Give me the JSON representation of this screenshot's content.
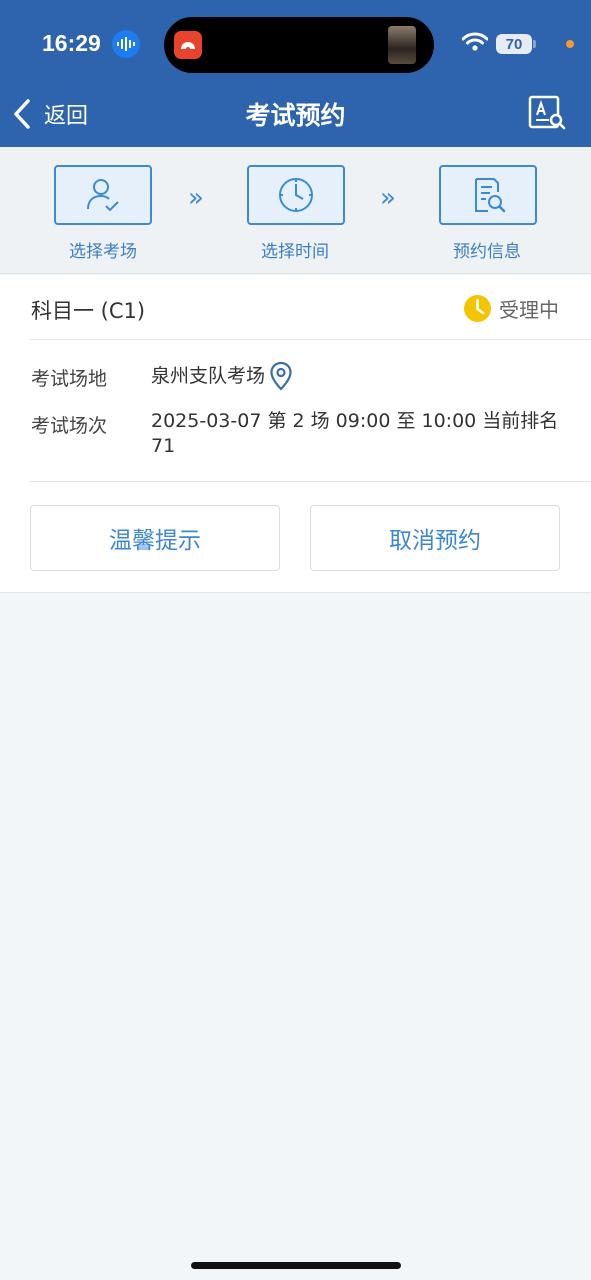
{
  "status_bar": {
    "time": "16:29",
    "battery": "70"
  },
  "nav": {
    "back_label": "返回",
    "title": "考试预约"
  },
  "steps": [
    {
      "label": "选择考场",
      "icon": "person-check-icon"
    },
    {
      "label": "选择时间",
      "icon": "clock-icon"
    },
    {
      "label": "预约信息",
      "icon": "document-search-icon"
    }
  ],
  "step_arrow": "»",
  "booking": {
    "subject": "科目一 (C1)",
    "status": "受理中",
    "venue_label": "考试场地",
    "venue_value": "泉州支队考场",
    "session_label": "考试场次",
    "session_value": "2025-03-07 第 2 场 09:00 至 10:00 当前排名71"
  },
  "buttons": {
    "tips": "温馨提示",
    "cancel": "取消预约"
  },
  "colors": {
    "header": "#2e64ad",
    "accent": "#3a8bd6",
    "status_badge": "#f5c400"
  }
}
